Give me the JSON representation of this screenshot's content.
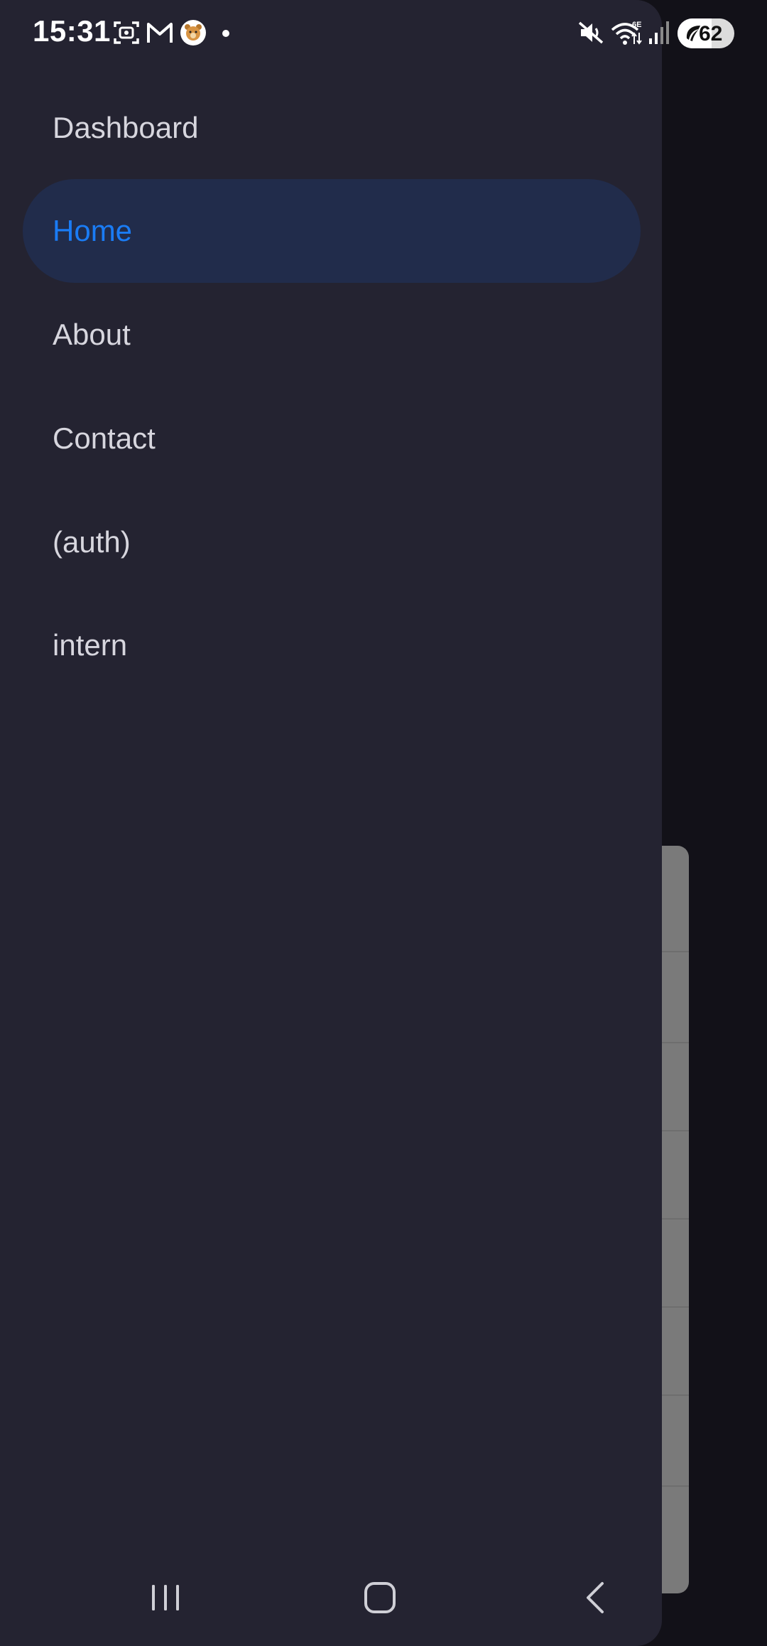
{
  "status_bar": {
    "time": "15:31",
    "battery_level": "62",
    "notification_icons": [
      "screenshot-icon",
      "gmail-icon",
      "bear-app-icon",
      "dot-icon"
    ],
    "system_icons": [
      "mute-icon",
      "wifi-6e-icon",
      "signal-icon",
      "battery-icon"
    ]
  },
  "drawer": {
    "items": [
      {
        "label": "Dashboard",
        "active": false
      },
      {
        "label": "Home",
        "active": true
      },
      {
        "label": "About",
        "active": false
      },
      {
        "label": "Contact",
        "active": false
      },
      {
        "label": "(auth)",
        "active": false
      },
      {
        "label": "intern",
        "active": false
      }
    ]
  },
  "nav_bar": {
    "buttons": [
      "recents-icon",
      "home-icon",
      "back-icon"
    ]
  },
  "colors": {
    "drawer_background": "#242331",
    "active_item_background": "#212c4b",
    "active_item_text": "#1a7cf5",
    "item_text": "#d7d6de",
    "scrim": "#121118"
  }
}
